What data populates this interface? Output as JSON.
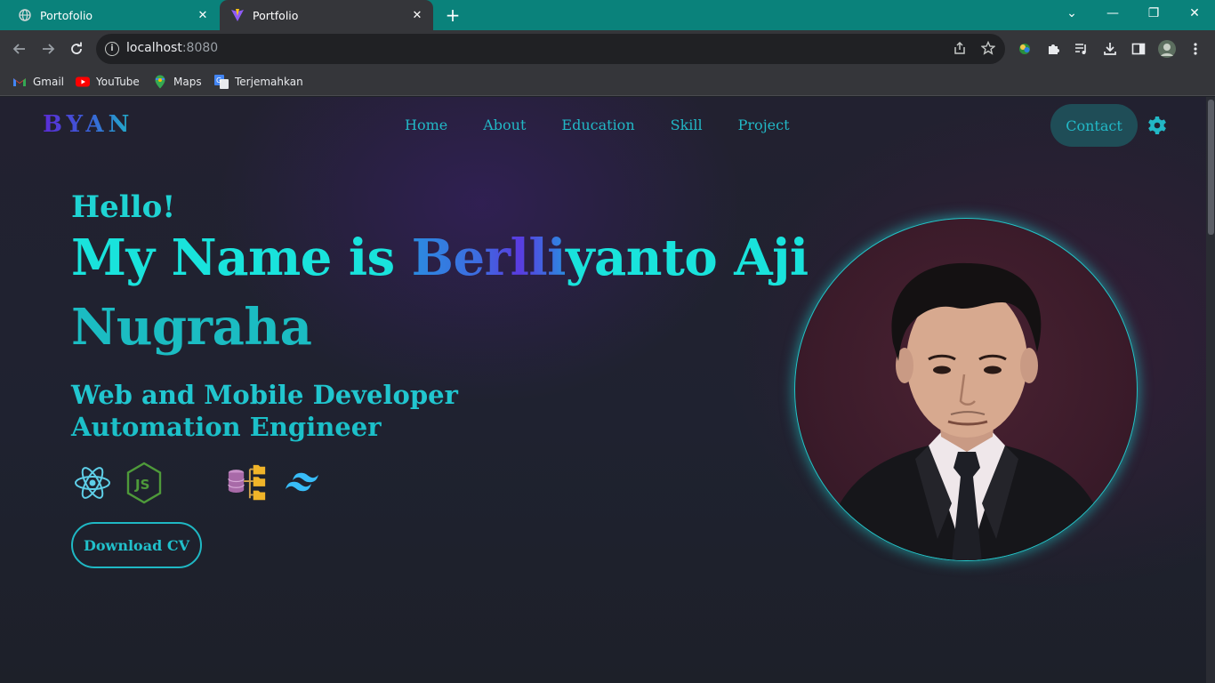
{
  "browser": {
    "tabs": [
      {
        "label": "Portofolio",
        "active": false,
        "icon": "globe-icon"
      },
      {
        "label": "Portfolio",
        "active": true,
        "icon": "vite-icon"
      }
    ],
    "new_tab": "+",
    "controls": {
      "minimize": "—",
      "maximize": "❐",
      "close": "✕",
      "tab_list": "⌄"
    },
    "url_host": "localhost",
    "url_port": ":8080",
    "bookmarks": [
      {
        "label": "Gmail",
        "icon": "gmail-icon"
      },
      {
        "label": "YouTube",
        "icon": "youtube-icon"
      },
      {
        "label": "Maps",
        "icon": "maps-icon"
      },
      {
        "label": "Terjemahkan",
        "icon": "translate-icon"
      }
    ],
    "tab_bar_color": "#0a827b"
  },
  "site": {
    "logo": "BYAN",
    "nav": [
      "Home",
      "About",
      "Education",
      "Skill",
      "Project"
    ],
    "contact_label": "Contact",
    "settings_icon": "gear-icon"
  },
  "hero": {
    "greeting": "Hello!",
    "name_prefix": "My Name is ",
    "name_highlight": "Berlli",
    "name_rest": "yanto Aji",
    "name_line2": "Nugraha",
    "role1": "Web and Mobile Developer",
    "role2": "Automation Engineer",
    "skills": [
      "react-icon",
      "nodejs-icon",
      "database-icon",
      "tailwind-icon"
    ],
    "cv_label": "Download CV",
    "accent": "#1fd3d3"
  }
}
